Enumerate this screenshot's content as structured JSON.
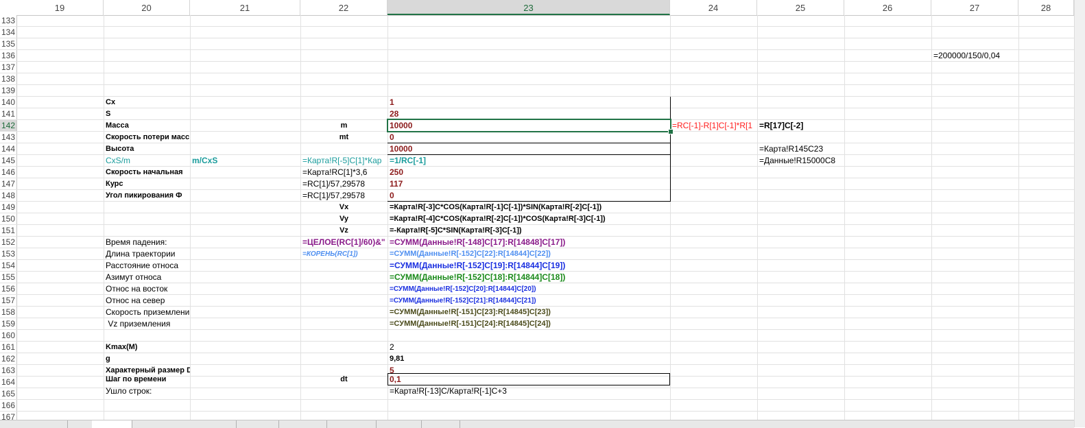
{
  "columns": [
    "19",
    "20",
    "21",
    "22",
    "23",
    "24",
    "25",
    "26",
    "27",
    "28"
  ],
  "active_column": "23",
  "rows": [
    "133",
    "134",
    "135",
    "136",
    "137",
    "138",
    "139",
    "140",
    "141",
    "142",
    "143",
    "144",
    "145",
    "146",
    "147",
    "148",
    "149",
    "150",
    "151",
    "152",
    "153",
    "154",
    "155",
    "156",
    "157",
    "158",
    "159",
    "160",
    "161",
    "162",
    "163",
    "164",
    "165",
    "166",
    "167"
  ],
  "active_row": "142",
  "cells": {
    "r136c27": "=200000/150/0,04",
    "r140c20": "Cx",
    "r140c23": "1",
    "r141c20": "S",
    "r141c23": "28",
    "r142c20": "Масса",
    "r142c22": "m",
    "r142c23": "10000",
    "r142c24": "=RC[-1]-R[1]C[-1]*R[1",
    "r142c25": "=R[17]C[-2]",
    "r143c20": "Скорость потери масс",
    "r143c22": "mt",
    "r143c23": "0",
    "r144c20": "Высота",
    "r144c23": "10000",
    "r144c25": "=Карта!R145C23",
    "r145c20": "CxS/m",
    "r145c21": "m/CxS",
    "r145c22": "=Карта!R[-5]C[1]*Кар",
    "r145c23": "=1/RC[-1]",
    "r145c25": "=Данные!R15000C8",
    "r146c20": "Скорость начальная",
    "r146c22": "=Карта!RC[1]*3,6",
    "r146c23": "250",
    "r147c20": "Курс",
    "r147c22": "=RC[1]/57,29578",
    "r147c23": "117",
    "r148c20": "Угол пикирования Ф",
    "r148c22": "=RC[1]/57,29578",
    "r148c23": "0",
    "r149c22": "Vx",
    "r149c23": "=Карта!R[-3]C*COS(Карта!R[-1]C[-1])*SIN(Карта!R[-2]C[-1])",
    "r150c22": "Vy",
    "r150c23": "=Карта!R[-4]C*COS(Карта!R[-2]C[-1])*COS(Карта!R[-3]C[-1])",
    "r151c22": "Vz",
    "r151c23": "=-Карта!R[-5]C*SIN(Карта!R[-3]C[-1])",
    "r152c20": "Время падения:",
    "r152c22": "=ЦЕЛОЕ(RC[1]/60)&\"",
    "r152c23": "=СУММ(Данные!R[-148]C[17]:R[14848]C[17])",
    "r153c20": "Длина траектории",
    "r153c22": "=КОРЕНЬ(RC[1])",
    "r153c23": "=СУММ(Данные!R[-152]C[22]:R[14844]C[22])",
    "r154c20": "Расстояние относа",
    "r154c23": "=СУММ(Данные!R[-152]C[19]:R[14844]C[19])",
    "r155c20": "Азимут относа",
    "r155c23": "=СУММ(Данные!R[-152]C[18]:R[14844]C[18])",
    "r156c20": "Относ на восток",
    "r156c23": "=СУММ(Данные!R[-152]C[20]:R[14844]C[20])",
    "r157c20": "Относ на север",
    "r157c23": "=СУММ(Данные!R[-152]C[21]:R[14844]C[21])",
    "r158c20": "Скорость приземлени",
    "r158c23": "=СУММ(Данные!R[-151]C[23]:R[14845]C[23])",
    "r159c20": " Vz приземления",
    "r159c23": "=СУММ(Данные!R[-151]C[24]:R[14845]C[24])",
    "r161c20": "Kmax(M)",
    "r161c23": "2",
    "r162c20": "g",
    "r162c23": "9,81",
    "r163c20": "Характерный размер D",
    "r163c23": "5",
    "r164c20": "Шаг по времени",
    "r164c22": "dt",
    "r164c23": "0,1",
    "r165c20": "Ушло строк:",
    "r165c23": "=Карта!R[-13]C/Карта!R[-1]C+3"
  },
  "colors": {
    "selection": "#217346",
    "dark_red": "#8b1a1a",
    "red": "#ff1a1a",
    "teal": "#1a9c9c",
    "purple": "#8a1b8a",
    "light_blue": "#4f8ff0",
    "blue": "#1a2fe0",
    "green": "#1a8a1a"
  }
}
